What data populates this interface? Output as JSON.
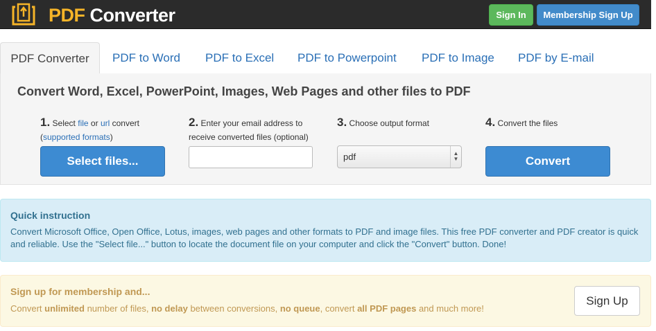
{
  "header": {
    "brand_pdf": "PDF",
    "brand_rest": "Converter",
    "sign_in": "Sign In",
    "membership": "Membership Sign Up",
    "logo_icon": "upload-document-icon"
  },
  "tabs": [
    {
      "label": "PDF Converter",
      "active": true
    },
    {
      "label": "PDF to Word"
    },
    {
      "label": "PDF to Excel"
    },
    {
      "label": "PDF to Powerpoint"
    },
    {
      "label": "PDF to Image"
    },
    {
      "label": "PDF by E-mail"
    }
  ],
  "converter": {
    "title": "Convert Word, Excel, PowerPoint, Images, Web Pages and other files to PDF",
    "step1": {
      "num": "1.",
      "pre": "Select",
      "file_link": "file",
      "or": "or",
      "url_link": "url",
      "post": "convert",
      "paren_open": "(",
      "formats_link": "supported formats",
      "paren_close": ")",
      "button": "Select files..."
    },
    "step2": {
      "num": "2.",
      "text": "Enter your email address to receive converted files (optional)",
      "email_value": ""
    },
    "step3": {
      "num": "3.",
      "text": "Choose output format",
      "selected": "pdf"
    },
    "step4": {
      "num": "4.",
      "text": "Convert the files",
      "button": "Convert"
    }
  },
  "quick": {
    "title": "Quick instruction",
    "body": "Convert Microsoft Office, Open Office, Lotus, images, web pages and other formats to PDF and image files. This free PDF converter and PDF creator is quick and reliable. Use the \"Select file...\" button to locate the document file on your computer and click the \"Convert\" button. Done!"
  },
  "signup": {
    "title": "Sign up for membership and...",
    "b1": "Convert",
    "b1_strong": "unlimited",
    "b2": "number of files,",
    "b2_strong": "no delay",
    "b3": "between conversions,",
    "b3_strong": "no queue",
    "b4": ", convert",
    "b4_strong": "all PDF pages",
    "b5": "and much more!",
    "button": "Sign Up"
  },
  "colors": {
    "brand_orange": "#f6b428",
    "primary_blue": "#428bca",
    "success_green": "#5cb85c",
    "info_bg": "#d9edf7",
    "warning_bg": "#fcf8e3"
  }
}
